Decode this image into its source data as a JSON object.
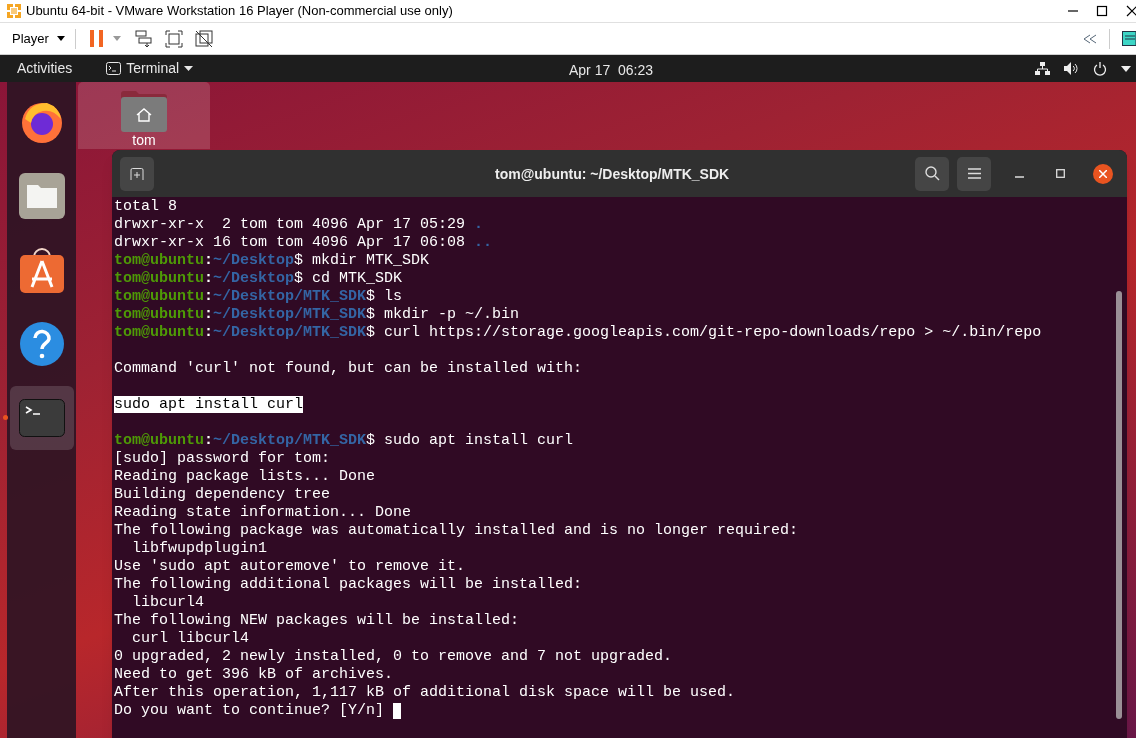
{
  "host_window": {
    "title": "Ubuntu 64-bit - VMware Workstation 16 Player (Non-commercial use only)"
  },
  "host_toolbar": {
    "menu": "Player"
  },
  "top_bar": {
    "activities": "Activities",
    "app_menu": "Terminal",
    "clock": "Apr 17  06:23"
  },
  "dock": [
    {
      "kind": "firefox",
      "selected": false,
      "running": false
    },
    {
      "kind": "files",
      "selected": false,
      "running": false
    },
    {
      "kind": "software",
      "selected": false,
      "running": false
    },
    {
      "kind": "help",
      "selected": false,
      "running": false
    },
    {
      "kind": "terminal",
      "selected": true,
      "running": true
    }
  ],
  "desktop_icons": [
    {
      "label": "tom"
    }
  ],
  "terminal": {
    "title": "tom@ubuntu: ~/Desktop/MTK_SDK",
    "lines": [
      {
        "kind": "output",
        "text": "total 8"
      },
      {
        "kind": "listing",
        "text": "drwxr-xr-x  2 tom tom 4096 Apr 17 05:29 ",
        "entry": "."
      },
      {
        "kind": "listing",
        "text": "drwxr-xr-x 16 tom tom 4096 Apr 17 06:08 ",
        "entry": ".."
      },
      {
        "kind": "prompt",
        "user": "tom@ubuntu",
        "sep": ":",
        "path": "~/Desktop",
        "command": "$ mkdir MTK_SDK"
      },
      {
        "kind": "prompt",
        "user": "tom@ubuntu",
        "sep": ":",
        "path": "~/Desktop",
        "command": "$ cd MTK_SDK"
      },
      {
        "kind": "prompt",
        "user": "tom@ubuntu",
        "sep": ":",
        "path": "~/Desktop/MTK_SDK",
        "command": "$ ls"
      },
      {
        "kind": "prompt",
        "user": "tom@ubuntu",
        "sep": ":",
        "path": "~/Desktop/MTK_SDK",
        "command": "$ mkdir -p ~/.bin"
      },
      {
        "kind": "prompt",
        "user": "tom@ubuntu",
        "sep": ":",
        "path": "~/Desktop/MTK_SDK",
        "command": "$ curl https://storage.googleapis.com/git-repo-downloads/repo > ~/.bin/repo"
      },
      {
        "kind": "blank"
      },
      {
        "kind": "output",
        "text": "Command 'curl' not found, but can be installed with:"
      },
      {
        "kind": "blank"
      },
      {
        "kind": "highlight",
        "text": "sudo apt install curl"
      },
      {
        "kind": "blank"
      },
      {
        "kind": "prompt",
        "user": "tom@ubuntu",
        "sep": ":",
        "path": "~/Desktop/MTK_SDK",
        "command": "$ sudo apt install curl"
      },
      {
        "kind": "output",
        "text": "[sudo] password for tom:"
      },
      {
        "kind": "output",
        "text": "Reading package lists... Done"
      },
      {
        "kind": "output",
        "text": "Building dependency tree"
      },
      {
        "kind": "output",
        "text": "Reading state information... Done"
      },
      {
        "kind": "output",
        "text": "The following package was automatically installed and is no longer required:"
      },
      {
        "kind": "output",
        "text": "  libfwupdplugin1"
      },
      {
        "kind": "output",
        "text": "Use 'sudo apt autoremove' to remove it."
      },
      {
        "kind": "output",
        "text": "The following additional packages will be installed:"
      },
      {
        "kind": "output",
        "text": "  libcurl4"
      },
      {
        "kind": "output",
        "text": "The following NEW packages will be installed:"
      },
      {
        "kind": "output",
        "text": "  curl libcurl4"
      },
      {
        "kind": "output",
        "text": "0 upgraded, 2 newly installed, 0 to remove and 7 not upgraded."
      },
      {
        "kind": "output",
        "text": "Need to get 396 kB of archives."
      },
      {
        "kind": "output",
        "text": "After this operation, 1,117 kB of additional disk space will be used."
      },
      {
        "kind": "output",
        "text": "Do you want to continue? [Y/n] ",
        "cursor": true
      }
    ]
  }
}
